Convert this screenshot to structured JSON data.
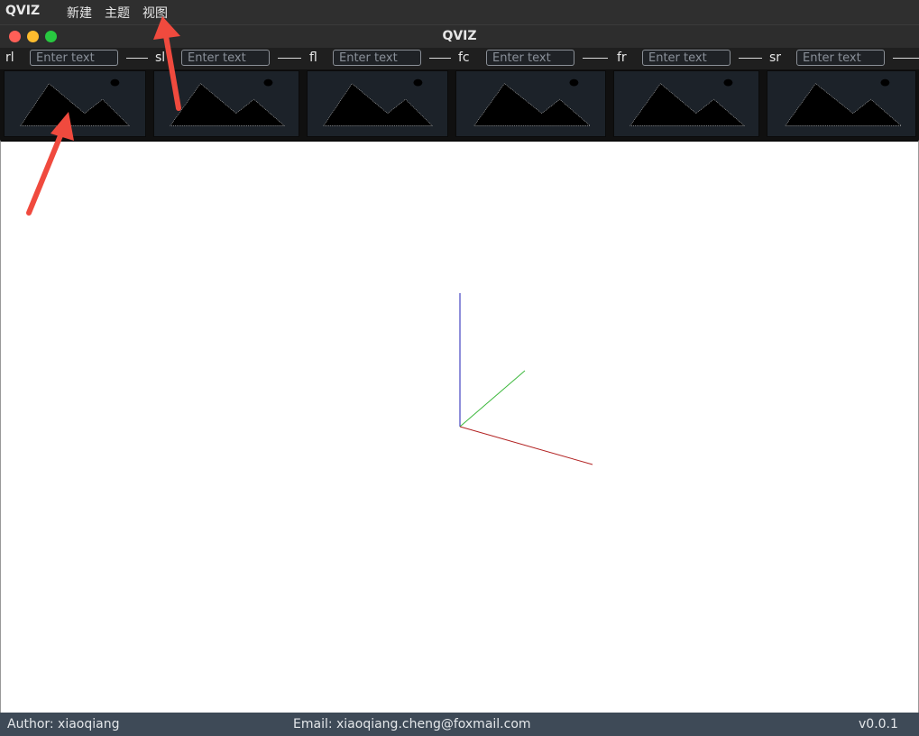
{
  "menubar": {
    "app_name": "QVIZ",
    "items": [
      {
        "label": "新建"
      },
      {
        "label": "主题"
      },
      {
        "label": "视图"
      }
    ]
  },
  "window": {
    "title": "QVIZ",
    "buttons": [
      {
        "name": "close",
        "color": "#ff5f57"
      },
      {
        "name": "minimize",
        "color": "#febc2e"
      },
      {
        "name": "maximize",
        "color": "#28c840"
      }
    ]
  },
  "cameras": [
    {
      "label": "rl",
      "placeholder": "Enter text"
    },
    {
      "label": "sl",
      "placeholder": "Enter text"
    },
    {
      "label": "fl",
      "placeholder": "Enter text"
    },
    {
      "label": "fc",
      "placeholder": "Enter text"
    },
    {
      "label": "fr",
      "placeholder": "Enter text"
    },
    {
      "label": "sr",
      "placeholder": "Enter text"
    }
  ],
  "thumbnails": [
    {
      "icon": "image-placeholder-icon"
    },
    {
      "icon": "image-placeholder-icon"
    },
    {
      "icon": "image-placeholder-icon"
    },
    {
      "icon": "image-placeholder-icon"
    },
    {
      "icon": "image-placeholder-icon"
    },
    {
      "icon": "image-placeholder-icon"
    }
  ],
  "viewport": {
    "axes_colors": {
      "x": "#b22222",
      "y": "#3cb83c",
      "z": "#1f1fb5"
    }
  },
  "statusbar": {
    "author": "Author: xiaoqiang",
    "email": "Email: xiaoqiang.cheng@foxmail.com",
    "version": "v0.0.1"
  },
  "annotations": {
    "arrow_color": "#f04a3e"
  }
}
